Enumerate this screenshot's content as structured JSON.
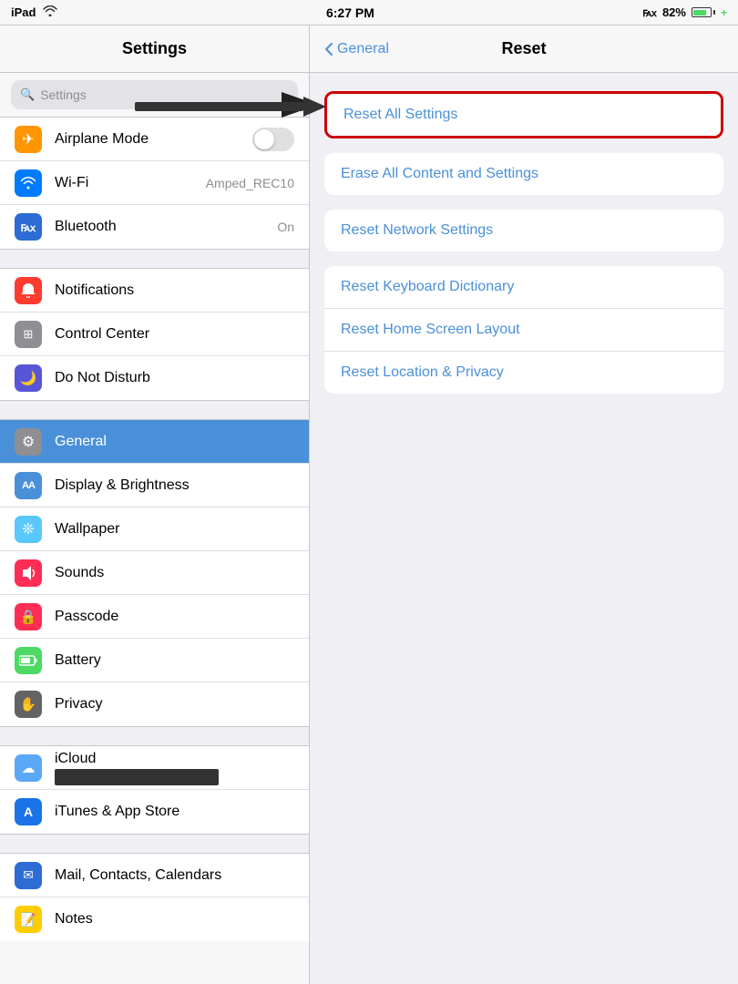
{
  "statusBar": {
    "device": "iPad",
    "wifi": "wifi-icon",
    "time": "6:27 PM",
    "bluetooth": "bluetooth-icon",
    "battery": "82%"
  },
  "sidebar": {
    "title": "Settings",
    "search": {
      "placeholder": "Settings",
      "icon": "search"
    },
    "sections": [
      {
        "items": [
          {
            "id": "airplane-mode",
            "label": "Airplane Mode",
            "iconColor": "icon-orange",
            "iconChar": "✈",
            "hasToggle": true,
            "toggleOn": false
          },
          {
            "id": "wifi",
            "label": "Wi-Fi",
            "iconColor": "icon-blue",
            "iconChar": "wifi",
            "value": "Amped_REC10"
          },
          {
            "id": "bluetooth",
            "label": "Bluetooth",
            "iconColor": "icon-blue-dark",
            "iconChar": "bt",
            "value": "On"
          }
        ]
      },
      {
        "items": [
          {
            "id": "notifications",
            "label": "Notifications",
            "iconColor": "icon-red",
            "iconChar": "🔔"
          },
          {
            "id": "control-center",
            "label": "Control Center",
            "iconColor": "icon-gray",
            "iconChar": "⊞"
          },
          {
            "id": "do-not-disturb",
            "label": "Do Not Disturb",
            "iconColor": "icon-purple",
            "iconChar": "🌙"
          }
        ]
      },
      {
        "items": [
          {
            "id": "general",
            "label": "General",
            "iconColor": "icon-gray",
            "iconChar": "⚙",
            "active": true
          },
          {
            "id": "display",
            "label": "Display & Brightness",
            "iconColor": "icon-blue-mid",
            "iconChar": "AA"
          },
          {
            "id": "wallpaper",
            "label": "Wallpaper",
            "iconColor": "icon-teal",
            "iconChar": "❊"
          },
          {
            "id": "sounds",
            "label": "Sounds",
            "iconColor": "icon-pink",
            "iconChar": "🔊"
          },
          {
            "id": "passcode",
            "label": "Passcode",
            "iconColor": "icon-pink",
            "iconChar": "🔒"
          },
          {
            "id": "battery",
            "label": "Battery",
            "iconColor": "icon-green",
            "iconChar": "⬜"
          },
          {
            "id": "privacy",
            "label": "Privacy",
            "iconColor": "icon-dark-gray",
            "iconChar": "✋"
          }
        ]
      },
      {
        "items": [
          {
            "id": "icloud",
            "label": "iCloud",
            "iconColor": "icon-cloud",
            "iconChar": "☁",
            "hasRedaction": true
          },
          {
            "id": "itunes",
            "label": "iTunes & App Store",
            "iconColor": "icon-app-store",
            "iconChar": "A"
          }
        ]
      },
      {
        "items": [
          {
            "id": "mail",
            "label": "Mail, Contacts, Calendars",
            "iconColor": "icon-mail",
            "iconChar": "✉"
          },
          {
            "id": "notes",
            "label": "Notes",
            "iconColor": "icon-notes-yellow",
            "iconChar": "📝"
          }
        ]
      }
    ]
  },
  "mainPanel": {
    "navBack": "General",
    "navTitle": "Reset",
    "resetItems": {
      "highlighted": "Reset All Settings",
      "single": "Erase All Content and Settings",
      "single2": "Reset Network Settings",
      "group": [
        "Reset Keyboard Dictionary",
        "Reset Home Screen Layout",
        "Reset Location & Privacy"
      ]
    }
  }
}
